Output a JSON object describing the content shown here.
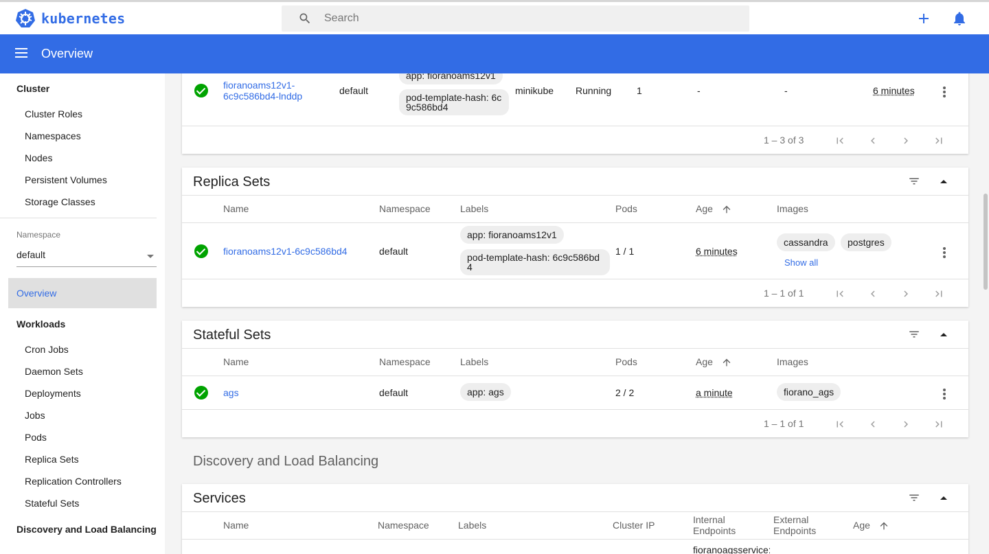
{
  "brand": {
    "name": "kubernetes"
  },
  "search": {
    "placeholder": "Search"
  },
  "appbar": {
    "title": "Overview"
  },
  "sidebar": {
    "cluster_heading": "Cluster",
    "cluster_items": [
      "Cluster Roles",
      "Namespaces",
      "Nodes",
      "Persistent Volumes",
      "Storage Classes"
    ],
    "namespace_label": "Namespace",
    "namespace_value": "default",
    "overview": "Overview",
    "workloads_heading": "Workloads",
    "workload_items": [
      "Cron Jobs",
      "Daemon Sets",
      "Deployments",
      "Jobs",
      "Pods",
      "Replica Sets",
      "Replication Controllers",
      "Stateful Sets"
    ],
    "discovery_heading": "Discovery and Load Balancing"
  },
  "pods_card": {
    "row": {
      "name_line1": "fioranoams12v1-",
      "name_line2": "6c9c586bd4-lnddp",
      "namespace": "default",
      "label1": "app: fioranoams12v1",
      "label2_line1": "pod-template-hash: 6c",
      "label2_line2": "9c586bd4",
      "node": "minikube",
      "status": "Running",
      "restarts": "1",
      "cpu": "-",
      "memory": "-",
      "age": "6 minutes"
    },
    "pager": "1 – 3 of 3"
  },
  "replica_sets": {
    "title": "Replica Sets",
    "headers": {
      "name": "Name",
      "namespace": "Namespace",
      "labels": "Labels",
      "pods": "Pods",
      "age": "Age",
      "images": "Images"
    },
    "row": {
      "name": "fioranoams12v1-6c9c586bd4",
      "namespace": "default",
      "label1": "app: fioranoams12v1",
      "label2_line1": "pod-template-hash: 6c9c586bd",
      "label2_line2": "4",
      "pods": "1 / 1",
      "age": "6 minutes",
      "image1": "cassandra",
      "image2": "postgres",
      "show_all": "Show all"
    },
    "pager": "1 – 1 of 1"
  },
  "stateful_sets": {
    "title": "Stateful Sets",
    "headers": {
      "name": "Name",
      "namespace": "Namespace",
      "labels": "Labels",
      "pods": "Pods",
      "age": "Age",
      "images": "Images"
    },
    "row": {
      "name": "ags",
      "namespace": "default",
      "label1": "app: ags",
      "pods": "2 / 2",
      "age": "a minute",
      "image1": "fiorano_ags"
    },
    "pager": "1 – 1 of 1"
  },
  "discovery_section": {
    "title": "Discovery and Load Balancing"
  },
  "services": {
    "title": "Services",
    "headers": {
      "name": "Name",
      "namespace": "Namespace",
      "labels": "Labels",
      "cluster_ip": "Cluster IP",
      "internal_line1": "Internal",
      "internal_line2": "Endpoints",
      "external_line1": "External",
      "external_line2": "Endpoints",
      "age": "Age"
    },
    "partial_row": {
      "internal": "fioranoagsservice:"
    }
  }
}
